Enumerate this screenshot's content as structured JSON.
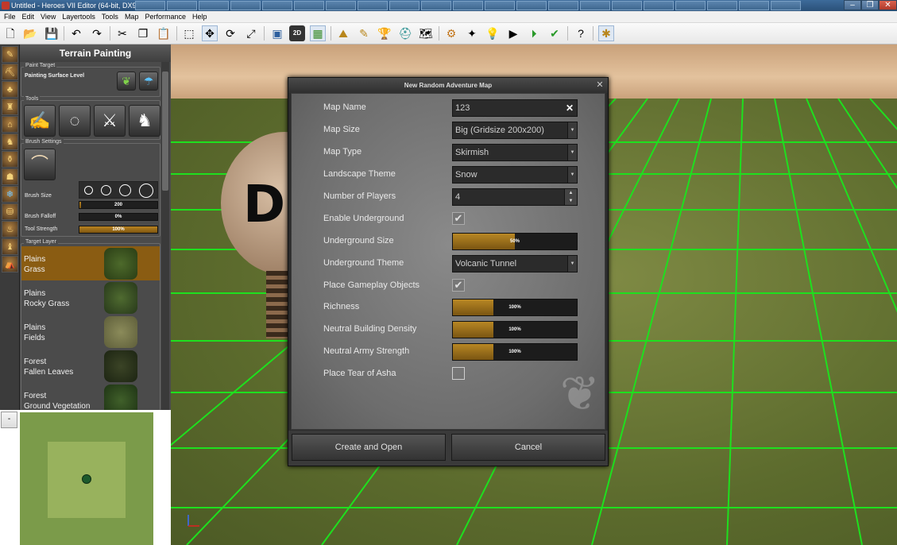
{
  "window": {
    "title": "Untitled - Heroes VII Editor (64-bit, DX9)",
    "buttons": {
      "minimize": "–",
      "restore": "❐",
      "close": "✕"
    }
  },
  "menu": [
    "File",
    "Edit",
    "View",
    "Layertools",
    "Tools",
    "Map",
    "Performance",
    "Help"
  ],
  "toolbar": {
    "icons": [
      "new-icon",
      "open-icon",
      "save-icon",
      "undo-icon",
      "redo-icon",
      "cut-icon",
      "copy-icon",
      "paste-icon",
      "select-icon",
      "move-icon",
      "rotate-icon",
      "scale-icon",
      "camera-icon",
      "2d-view-icon",
      "grid-icon",
      "terrain-icon",
      "paint-icon",
      "trophy-icon",
      "helmet-icon",
      "map-icon",
      "gears-icon",
      "compass-icon",
      "light-icon",
      "script-icon",
      "play-icon",
      "check-icon",
      "help-icon",
      "settings-icon"
    ],
    "label_2d": "2D"
  },
  "terrain_panel": {
    "title": "Terrain Painting",
    "paint_target": {
      "section": "Paint Target",
      "label": "Painting Surface Level"
    },
    "tools": {
      "section": "Tools"
    },
    "brush": {
      "section": "Brush Settings",
      "size_label": "Brush Size",
      "size_value": "200",
      "size_fill": 0.02,
      "falloff_label": "Brush Falloff",
      "falloff_value": "0%",
      "falloff_fill": 0.0,
      "strength_label": "Tool Strength",
      "strength_value": "100%",
      "strength_fill": 1.0
    },
    "target_layer": {
      "section": "Target Layer",
      "layers": [
        {
          "line1": "Plains",
          "line2": "Grass",
          "selected": true
        },
        {
          "line1": "Plains",
          "line2": "Rocky Grass",
          "selected": false
        },
        {
          "line1": "Plains",
          "line2": "Fields",
          "selected": false
        },
        {
          "line1": "Forest",
          "line2": "Fallen Leaves",
          "selected": false
        },
        {
          "line1": "Forest",
          "line2": "Ground Vegetation",
          "selected": false
        }
      ]
    }
  },
  "minimap": {
    "toggle_label": "-"
  },
  "viewport": {
    "object_letter": "D"
  },
  "dialog": {
    "title": "New Random Adventure Map",
    "close": "✕",
    "fields": {
      "map_name": {
        "label": "Map Name",
        "value": "123",
        "clear": "✕"
      },
      "map_size": {
        "label": "Map Size",
        "value": "Big (Gridsize 200x200)"
      },
      "map_type": {
        "label": "Map Type",
        "value": "Skirmish"
      },
      "landscape_theme": {
        "label": "Landscape Theme",
        "value": "Snow"
      },
      "players": {
        "label": "Number of Players",
        "value": "4"
      },
      "enable_underground": {
        "label": "Enable Underground",
        "checked": true
      },
      "underground_size": {
        "label": "Underground Size",
        "value": "50%",
        "level": 0.5
      },
      "underground_theme": {
        "label": "Underground Theme",
        "value": "Volcanic Tunnel"
      },
      "gameplay_objects": {
        "label": "Place Gameplay Objects",
        "checked": true
      },
      "richness": {
        "label": "Richness",
        "value": "100%",
        "level": 0.33
      },
      "building_density": {
        "label": "Neutral Building Density",
        "value": "100%",
        "level": 0.33
      },
      "army_strength": {
        "label": "Neutral Army Strength",
        "value": "100%",
        "level": 0.33
      },
      "tear_of_asha": {
        "label": "Place Tear of Asha",
        "checked": false
      }
    },
    "buttons": {
      "create": "Create and Open",
      "cancel": "Cancel"
    }
  }
}
